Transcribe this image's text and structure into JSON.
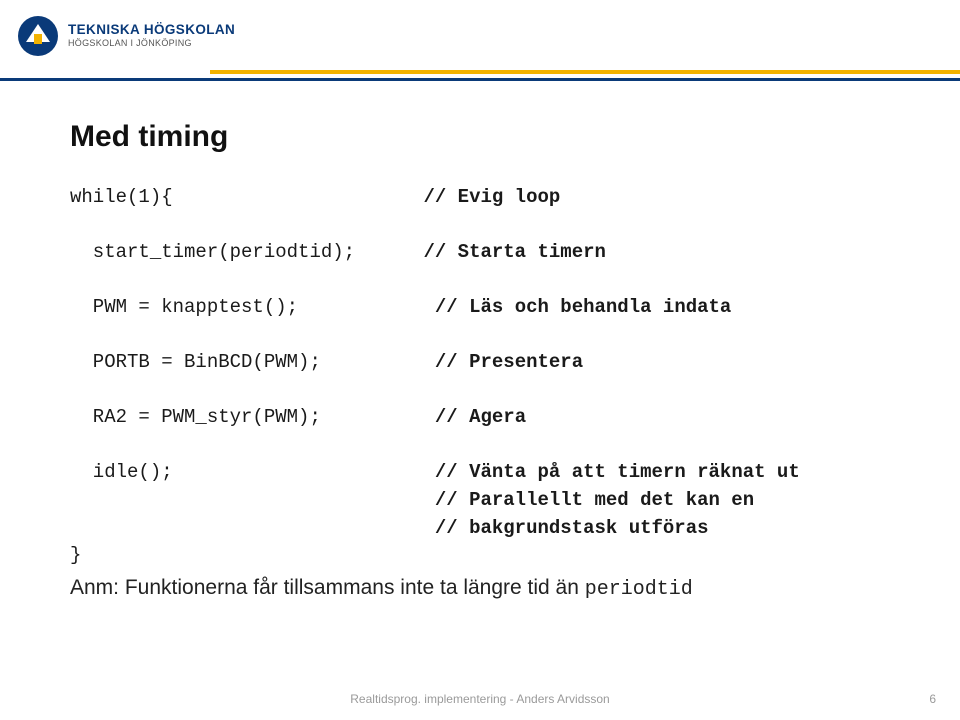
{
  "logo": {
    "main": "TEKNISKA HÖGSKOLAN",
    "sub": "HÖGSKOLAN I JÖNKÖPING"
  },
  "title": "Med timing",
  "code": {
    "l1a": "while(1){",
    "l1b": "// Evig loop",
    "l2a": "  start_timer(periodtid);",
    "l2b": "// Starta timern",
    "l3a": "  PWM = knapptest();",
    "l3b": "// Läs och behandla indata",
    "l4a": "  PORTB = BinBCD(PWM);",
    "l4b": "// Presentera",
    "l5a": "  RA2 = PWM_styr(PWM);",
    "l5b": "// Agera",
    "l6a": "  idle();",
    "l6b": "// Vänta på att timern räknat ut",
    "l7b": "// Parallellt med det kan en",
    "l8b": "// bakgrundstask utföras",
    "lend": "}"
  },
  "note": {
    "prefix": "Anm: Funktionerna får tillsammans inte ta längre tid än ",
    "mono": "periodtid"
  },
  "footer": "Realtidsprog. implementering - Anders Arvidsson",
  "page_num": "6"
}
